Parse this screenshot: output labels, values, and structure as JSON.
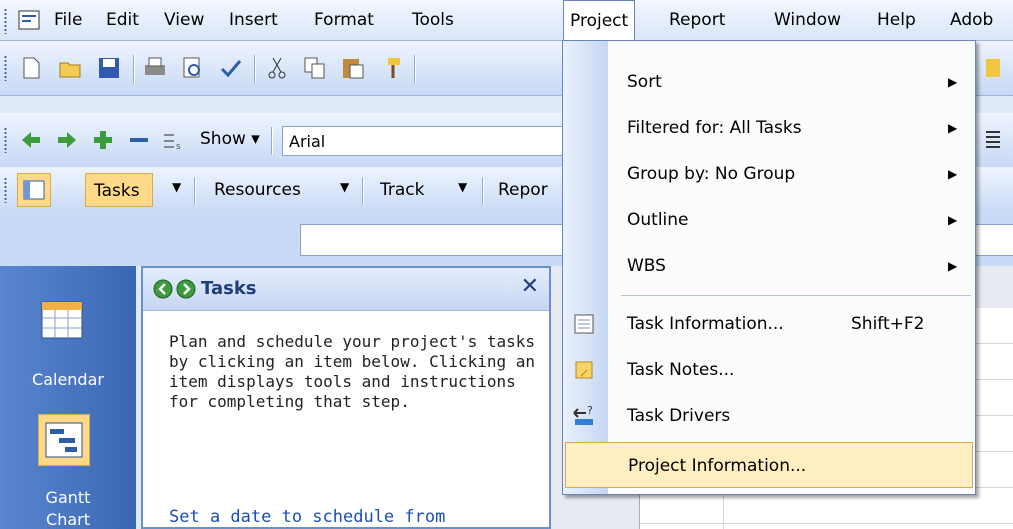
{
  "menubar": {
    "items": [
      "File",
      "Edit",
      "View",
      "Insert",
      "Format",
      "Tools",
      "Project",
      "Report",
      "Window",
      "Help",
      "Adob"
    ],
    "active": "Project"
  },
  "toolbar2": {
    "show_label": "Show ▾",
    "font_value": "Arial"
  },
  "toolbar3": {
    "tasks_label": "Tasks",
    "resources_label": "Resources",
    "track_label": "Track",
    "report_label": "Repor"
  },
  "viewbar": {
    "calendar_label": "Calendar",
    "gantt_label": "Gantt",
    "gantt_label2": "Chart"
  },
  "taskpane": {
    "title": "Tasks",
    "body": "Plan and schedule your project's tasks by clicking an item below. Clicking an item displays tools and instructions for completing that step.",
    "link": "Set a date to schedule from"
  },
  "project_menu": {
    "items": [
      {
        "label": "Sort",
        "submenu": true
      },
      {
        "label": "Filtered for: All Tasks",
        "submenu": true
      },
      {
        "label": "Group by: No Group",
        "submenu": true
      },
      {
        "label": "Outline",
        "submenu": true
      },
      {
        "label": "WBS",
        "submenu": true
      },
      {
        "label": "Task Information...",
        "shortcut": "Shift+F2"
      },
      {
        "label": "Task Notes..."
      },
      {
        "label": "Task Drivers"
      },
      {
        "label": "Project Information..."
      }
    ]
  }
}
